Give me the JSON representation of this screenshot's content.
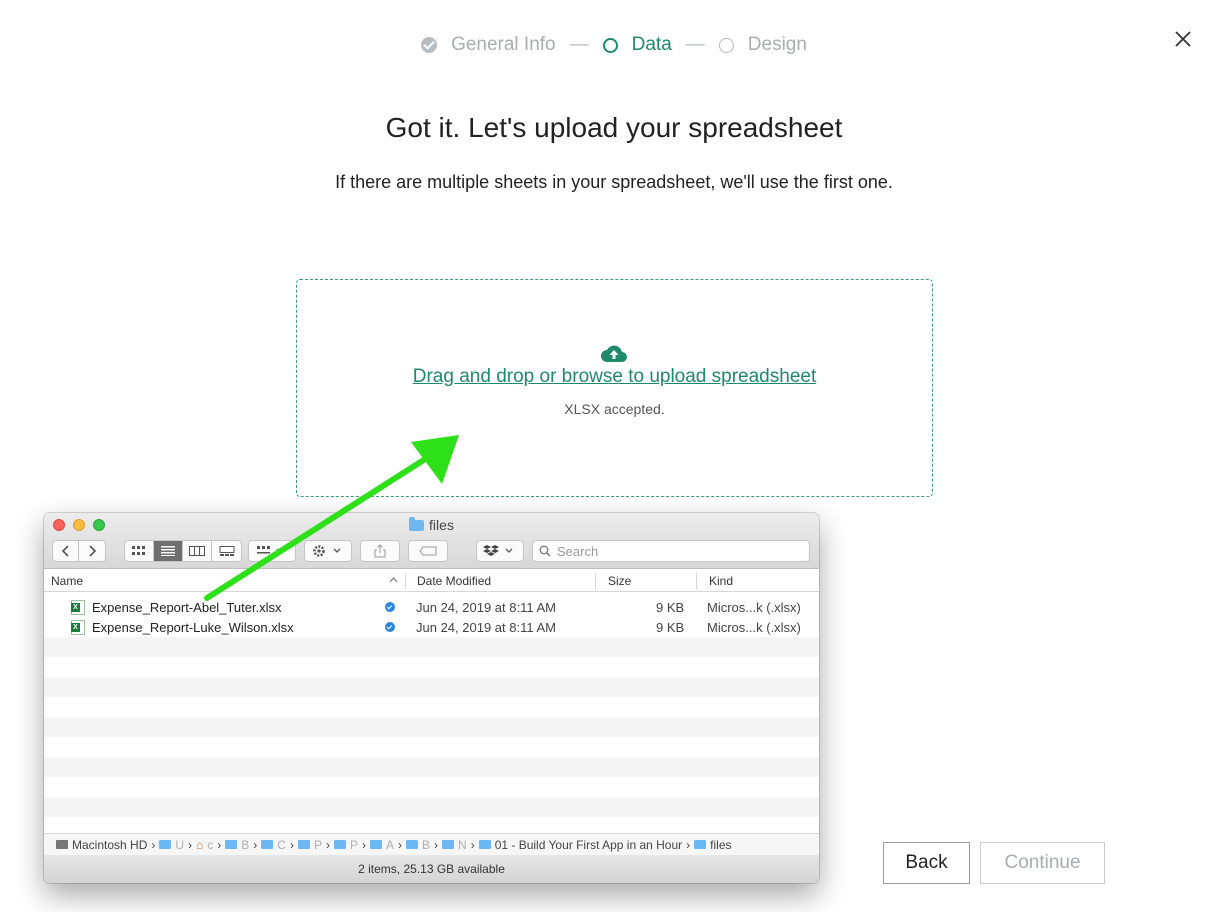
{
  "stepper": {
    "steps": [
      {
        "label": "General Info",
        "state": "done"
      },
      {
        "label": "Data",
        "state": "current"
      },
      {
        "label": "Design",
        "state": "todo"
      }
    ],
    "separator": "—"
  },
  "heading": "Got it. Let's upload your spreadsheet",
  "subtitle": "If there are multiple sheets in your spreadsheet, we'll use the first one.",
  "dropzone": {
    "link_text": "Drag and drop or browse to upload spreadsheet",
    "note": "XLSX accepted.",
    "icon": "cloud-upload-icon"
  },
  "finder": {
    "title": "files",
    "search_placeholder": "Search",
    "columns": {
      "name": "Name",
      "date": "Date Modified",
      "size": "Size",
      "kind": "Kind"
    },
    "files": [
      {
        "name": "Expense_Report-Abel_Tuter.xlsx",
        "date": "Jun 24, 2019 at 8:11 AM",
        "size": "9 KB",
        "kind": "Micros...k (.xlsx)"
      },
      {
        "name": "Expense_Report-Luke_Wilson.xlsx",
        "date": "Jun 24, 2019 at 8:11 AM",
        "size": "9 KB",
        "kind": "Micros...k (.xlsx)"
      }
    ],
    "path": {
      "root": "Macintosh HD",
      "collapsed": [
        "U",
        "c",
        "B",
        "C",
        "P",
        "P",
        "A",
        "B",
        "N"
      ],
      "folder": "01 - Build Your First App in an Hour",
      "leaf": "files"
    },
    "status": "2 items, 25.13 GB available"
  },
  "buttons": {
    "back": "Back",
    "continue": "Continue"
  },
  "colors": {
    "accent": "#1f8a6a",
    "arrow": "#2ee01a"
  }
}
